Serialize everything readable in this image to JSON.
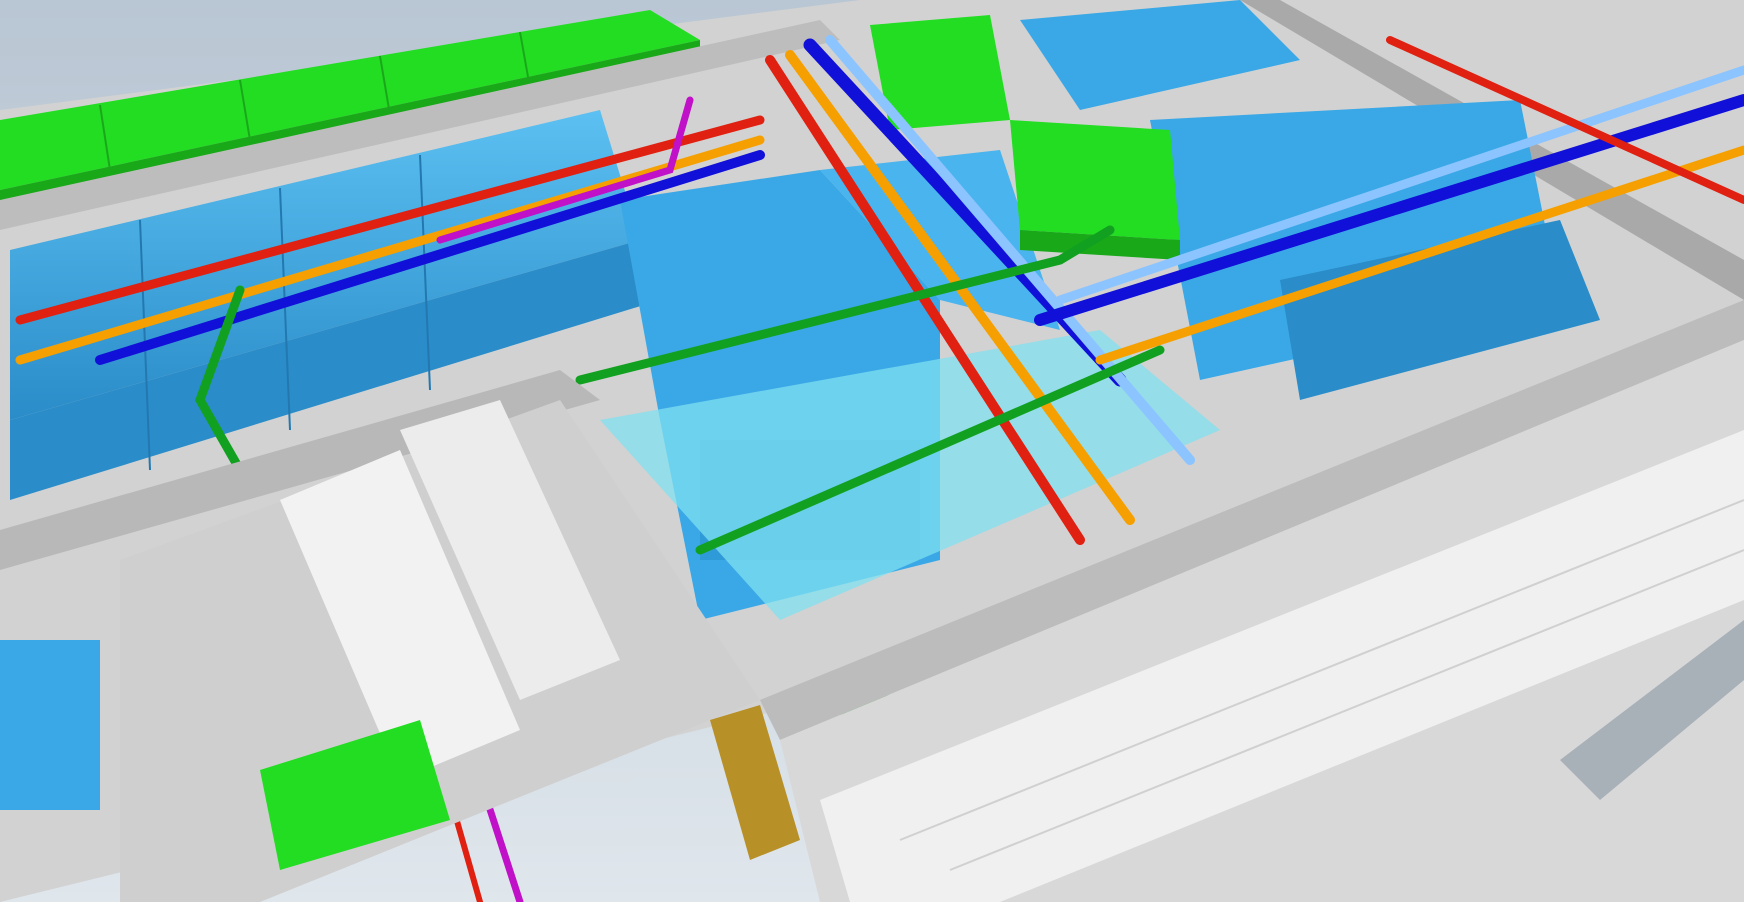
{
  "scene": {
    "colors": {
      "sky": "#c9d3dd",
      "concrete": "#c8c8c8",
      "concrete_dark": "#9d9d9d",
      "floor": "#d6d6d6",
      "duct_blue": "#3aa8e6",
      "duct_blue_dark": "#2a8cc8",
      "duct_green": "#22dd22",
      "glass_cyan": "#7fe0f0",
      "pipe_red": "#e02010",
      "pipe_orange": "#f5a000",
      "pipe_blue": "#1010d8",
      "pipe_lightblue": "#8cc4ff",
      "pipe_green": "#12a020",
      "pipe_magenta": "#c010c8",
      "cable_tray": "#f2f2f2",
      "door_brown": "#b89028"
    }
  }
}
